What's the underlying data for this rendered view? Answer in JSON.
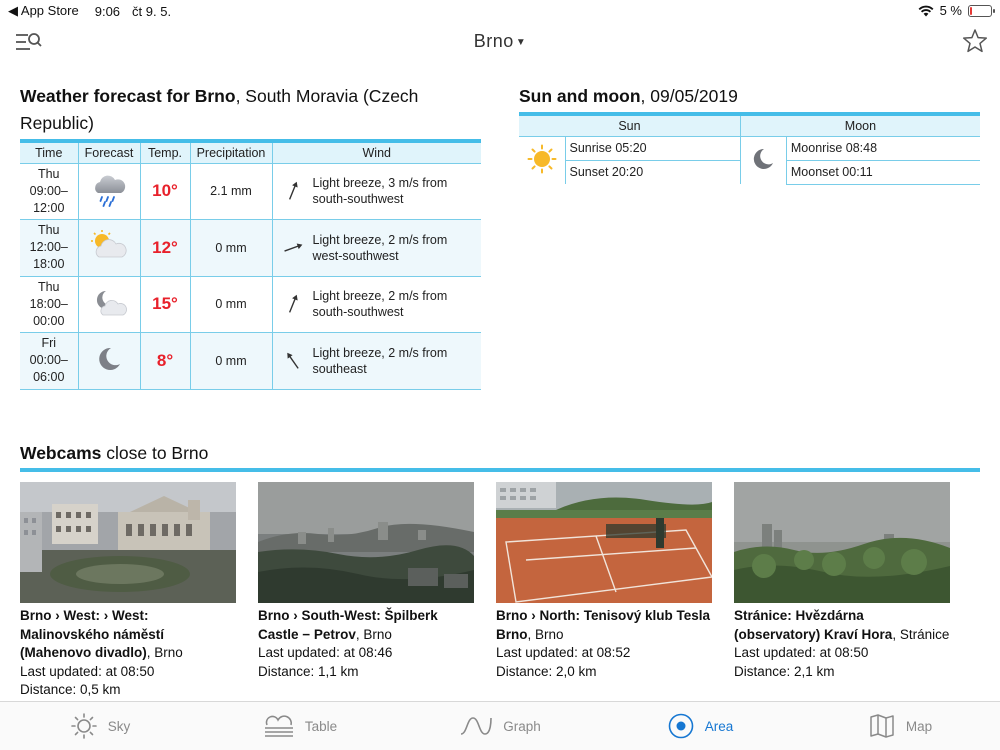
{
  "status": {
    "back_app": "App Store",
    "time": "9:06",
    "date": "čt 9. 5.",
    "battery": "5 %",
    "battery_level": 0.05
  },
  "nav": {
    "title": "Brno",
    "menu_icon": "search-list-icon",
    "star_icon": "star-icon"
  },
  "forecast": {
    "title_bold": "Weather forecast for Brno",
    "title_rest": ", South Moravia (Czech Republic)",
    "headers": [
      "Time",
      "Forecast",
      "Temp.",
      "Precipitation",
      "Wind"
    ],
    "rows": [
      {
        "day": "Thu",
        "from": "09:00–",
        "to": "12:00",
        "icon": "rain-cloud-icon",
        "temp": "10°",
        "precip": "2.1 mm",
        "wind": "Light breeze, 3 m/s from south-southwest",
        "wind_dir_deg": 22
      },
      {
        "day": "Thu",
        "from": "12:00–",
        "to": "18:00",
        "icon": "partly-cloudy-day-icon",
        "temp": "12°",
        "precip": "0 mm",
        "wind": "Light breeze, 2 m/s from west-southwest",
        "wind_dir_deg": 70
      },
      {
        "day": "Thu",
        "from": "18:00–",
        "to": "00:00",
        "icon": "partly-cloudy-night-icon",
        "temp": "15°",
        "precip": "0 mm",
        "wind": "Light breeze, 2 m/s from south-southwest",
        "wind_dir_deg": 22
      },
      {
        "day": "Fri",
        "from": "00:00–",
        "to": "06:00",
        "icon": "moon-icon",
        "temp": "8°",
        "precip": "0 mm",
        "wind": "Light breeze, 2 m/s from southeast",
        "wind_dir_deg": -35
      }
    ]
  },
  "sunmoon": {
    "title_bold": "Sun and moon",
    "title_rest": ", 09/05/2019",
    "sun_header": "Sun",
    "moon_header": "Moon",
    "sunrise": "Sunrise 05:20",
    "sunset": "Sunset 20:20",
    "moonrise": "Moonrise 08:48",
    "moonset": "Moonset 00:11"
  },
  "webcams": {
    "title_bold": "Webcams",
    "title_rest": " close to Brno",
    "items": [
      {
        "name_bold": "Brno › West: › West: Malinovského náměstí (Mahenovo divadlo)",
        "place": ", Brno",
        "updated": "Last updated: at 08:50",
        "distance": "Distance: 0,5 km",
        "scene": "theatre"
      },
      {
        "name_bold": "Brno › South-West: Špilberk Castle − Petrov",
        "place": ", Brno",
        "updated": "Last updated: at 08:46",
        "distance": "Distance: 1,1 km",
        "scene": "city"
      },
      {
        "name_bold": "Brno › North: Tenisový klub Tesla Brno",
        "place": ", Brno",
        "updated": "Last updated: at 08:52",
        "distance": "Distance: 2,0 km",
        "scene": "tennis"
      },
      {
        "name_bold": "Stránice: Hvězdárna (observatory) Kraví Hora",
        "place": ", Stránice",
        "updated": "Last updated: at 08:50",
        "distance": "Distance: 2,1 km",
        "scene": "hill"
      }
    ]
  },
  "tabs": [
    {
      "label": "Sky",
      "icon": "sun-icon",
      "active": false
    },
    {
      "label": "Table",
      "icon": "fog-table-icon",
      "active": false
    },
    {
      "label": "Graph",
      "icon": "wave-graph-icon",
      "active": false
    },
    {
      "label": "Area",
      "icon": "location-target-icon",
      "active": true
    },
    {
      "label": "Map",
      "icon": "map-icon",
      "active": false
    }
  ],
  "colors": {
    "accent": "#45bde8",
    "temp": "#e8212b",
    "active_tab": "#1677d2"
  }
}
